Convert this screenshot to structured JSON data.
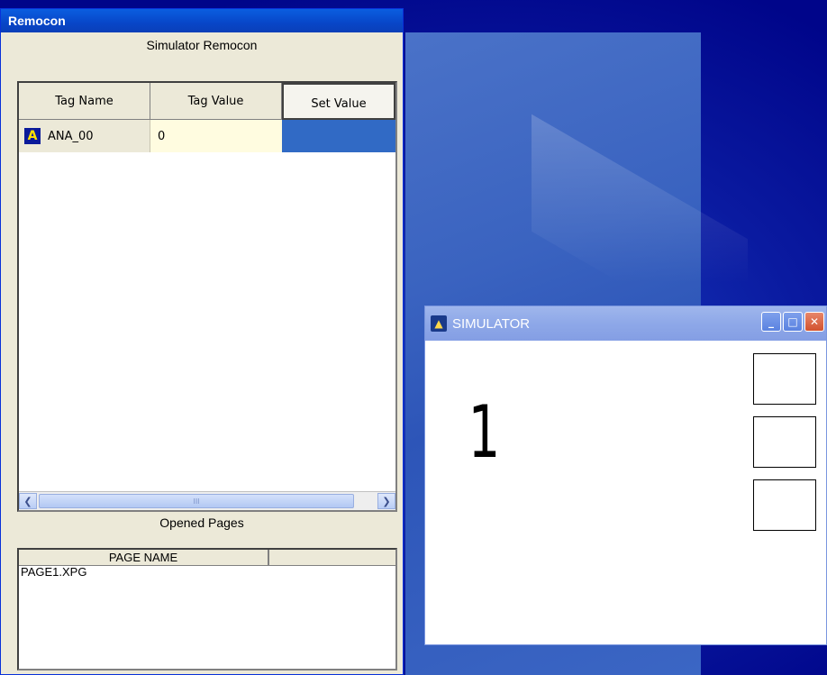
{
  "remocon": {
    "title": "Remocon",
    "heading": "Simulator Remocon",
    "columns": [
      "Tag Name",
      "Tag Value",
      "Set Value"
    ],
    "rows": [
      {
        "icon": "A",
        "tag_name": "ANA_00",
        "tag_value": "0",
        "set_value": ""
      }
    ],
    "scrollbar": {
      "thumb_grip": "III"
    },
    "opened_pages_heading": "Opened Pages",
    "pages_columns": [
      "PAGE NAME",
      ""
    ],
    "pages": [
      "PAGE1.XPG"
    ]
  },
  "simulator": {
    "title": "SIMULATOR",
    "display_value": "1",
    "buttons": {
      "minimize": "_",
      "maximize": "□",
      "close": "✕"
    }
  }
}
